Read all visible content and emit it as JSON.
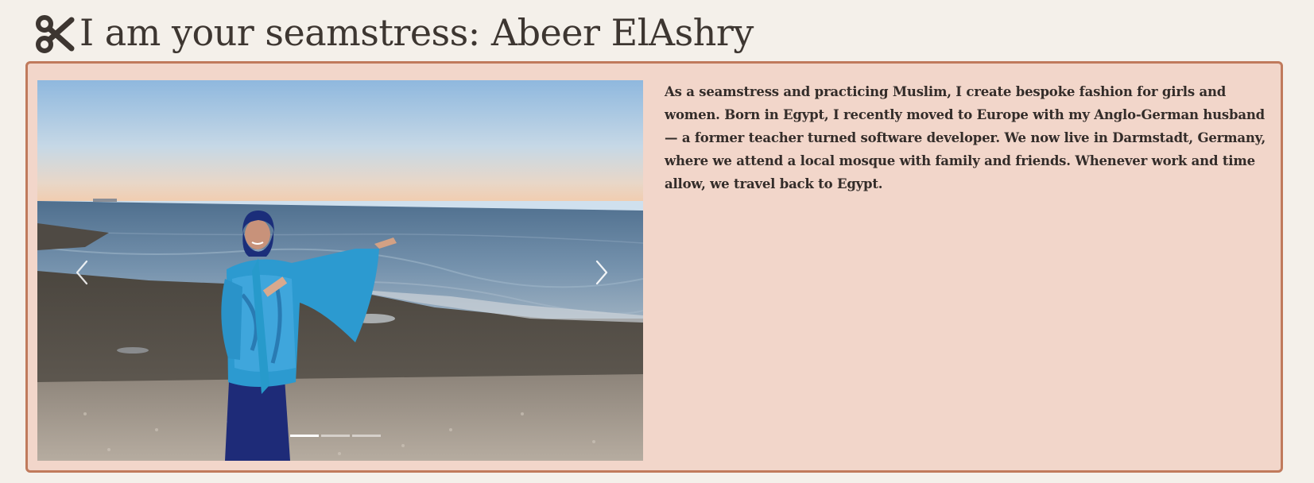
{
  "header": {
    "title": "I am your seamstress: Abeer ElAshry",
    "icon": "scissors-icon"
  },
  "colors": {
    "page_background": "#f4f0ea",
    "card_background": "#f2d6ca",
    "card_border": "#c07a5c",
    "text": "#332c29"
  },
  "carousel": {
    "prev_icon": "chevron-left-icon",
    "next_icon": "chevron-right-icon",
    "slide_count": 3,
    "active_index": 0
  },
  "bio": {
    "text": "As a seamstress and practicing Muslim, I create bespoke fashion for girls and women. Born in Egypt, I recently moved to Europe with my Anglo-German husband — a former teacher turned software developer. We now live in Darmstadt, Germany, where we attend a local mosque with family and friends. Whenever work and time allow, we travel back to Egypt."
  }
}
